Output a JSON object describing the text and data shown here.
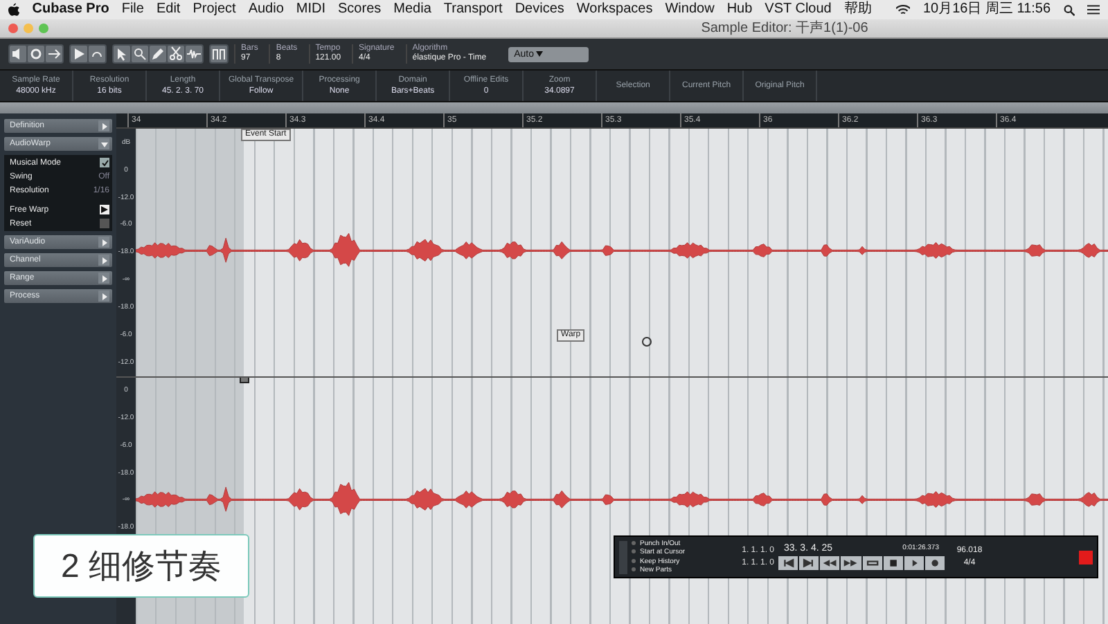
{
  "menu_bar": {
    "items": [
      "Cubase Pro",
      "File",
      "Edit",
      "Project",
      "Audio",
      "MIDI",
      "Scores",
      "Media",
      "Transport",
      "Devices",
      "Workspaces",
      "Window",
      "Hub",
      "VST Cloud",
      "帮助"
    ],
    "clock": "10月16日 周三 11:56"
  },
  "window": {
    "title": "Sample Editor: 干声1(1)-06"
  },
  "toolbar": {
    "fields": [
      {
        "label": "Bars",
        "value": "97"
      },
      {
        "label": "Beats",
        "value": "8"
      },
      {
        "label": "Tempo",
        "value": "121.00"
      },
      {
        "label": "Signature",
        "value": "4/4"
      },
      {
        "label": "Algorithm",
        "value": "élastique Pro - Time"
      }
    ],
    "mode": "Auto"
  },
  "info_line": [
    {
      "label": "Sample Rate",
      "value": "48000 kHz"
    },
    {
      "label": "Resolution",
      "value": "16 bits"
    },
    {
      "label": "Length",
      "value": "45. 2. 3. 70"
    },
    {
      "label": "Global Transpose",
      "value": "Follow"
    },
    {
      "label": "Processing",
      "value": "None"
    },
    {
      "label": "Domain",
      "value": "Bars+Beats"
    },
    {
      "label": "Offline Edits",
      "value": "0"
    },
    {
      "label": "Zoom",
      "value": "34.0897"
    },
    {
      "label": "Selection"
    },
    {
      "label": "Current Pitch"
    },
    {
      "label": "Original Pitch"
    }
  ],
  "inspector": {
    "sections": [
      {
        "title": "Definition",
        "expanded": false
      },
      {
        "title": "AudioWarp",
        "expanded": true,
        "rows": [
          {
            "kind": "checkbox",
            "label": "Musical Mode",
            "checked": true
          },
          {
            "kind": "value",
            "label": "Swing",
            "value": "Off"
          },
          {
            "kind": "value",
            "label": "Resolution",
            "value": "1/16"
          },
          {
            "kind": "toggle",
            "label": "Free Warp",
            "on": true
          },
          {
            "kind": "action",
            "label": "Reset"
          }
        ]
      },
      {
        "title": "VariAudio",
        "expanded": false
      },
      {
        "title": "Channel",
        "expanded": false
      },
      {
        "title": "Range",
        "expanded": false
      },
      {
        "title": "Process",
        "expanded": false
      }
    ]
  },
  "ruler": {
    "labels": [
      "34",
      "34.2",
      "34.3",
      "34.4",
      "35",
      "35.2",
      "35.3",
      "35.4",
      "36",
      "36.2",
      "36.3",
      "36.4"
    ]
  },
  "channels": [
    {
      "scale": [
        "dB",
        "0",
        "-12.0",
        "-6.0",
        "-18.0",
        "-∞",
        "-18.0",
        "-6.0",
        "-12.0"
      ]
    },
    {
      "scale": [
        "0",
        "-12.0",
        "-6.0",
        "-18.0",
        "-∞",
        "-18.0"
      ]
    }
  ],
  "tooltips": {
    "event_start": "Event Start",
    "cursor": "Warp"
  },
  "transport": {
    "options": [
      "Punch In/Out",
      "Start at Cursor",
      "Keep History",
      "New Parts"
    ],
    "locators": [
      "1. 1. 1. 0",
      "1. 1. 1. 0"
    ],
    "position": "33. 3. 4. 25",
    "time": "0:01:26.373",
    "tempo": "96.018",
    "signature": "4/4"
  },
  "caption": "2 细修节奏"
}
